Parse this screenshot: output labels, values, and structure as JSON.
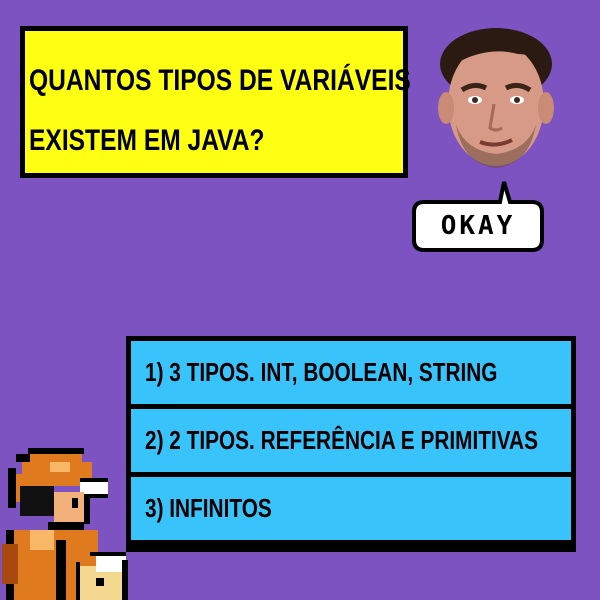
{
  "question": {
    "line1": "QUANTOS TIPOS DE VARIÁVEIS",
    "line2": "EXISTEM EM JAVA?"
  },
  "speech_bubble": {
    "label": "OKAY"
  },
  "answers": [
    {
      "label": "1) 3 TIPOS. INT, BOOLEAN, STRING"
    },
    {
      "label": "2) 2 TIPOS. REFERÊNCIA E PRIMITIVAS"
    },
    {
      "label": "3) INFINITOS"
    }
  ],
  "colors": {
    "background": "#7d53c1",
    "question_box": "#ffff14",
    "answer_box": "#38c3fb",
    "border": "#000000"
  },
  "icons": {
    "face": "face-avatar-icon",
    "trainer": "pixel-trainer-sprite-icon"
  }
}
